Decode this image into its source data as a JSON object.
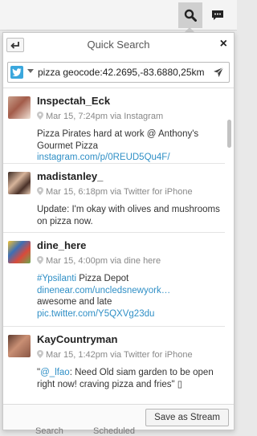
{
  "topbar": {
    "search_icon": "search-icon",
    "messages_icon": "chat-bubble-icon"
  },
  "panel": {
    "title": "Quick Search",
    "back_icon": "back-arrow-icon",
    "close_label": "×",
    "network_icon": "twitter-icon",
    "query_value": "pizza geocode:42.2695,-83.6880,25km",
    "send_icon": "paper-plane-icon"
  },
  "results": [
    {
      "user": "Inspectah_Eck",
      "meta": "Mar 15, 7:24pm via Instagram",
      "text": "Pizza Pirates hard at work @ Anthony's Gourmet Pizza",
      "link1": "instagram.com/p/0REUD5Qu4F/"
    },
    {
      "user": "madistanley_",
      "meta": "Mar 15, 6:18pm via Twitter for iPhone",
      "text": "Update: I'm okay with olives and mushrooms on pizza now."
    },
    {
      "user": "dine_here",
      "meta": "Mar 15, 4:00pm via dine here",
      "hashtag": "#Ypsilanti",
      "text_after_hashtag": " Pizza Depot",
      "link1": "dinenear.com/uncledsnewyork…",
      "text2": "awesome and late",
      "link2": "pic.twitter.com/Y5QXVg23du"
    },
    {
      "user": "KayCountryman",
      "meta": "Mar 15, 1:42pm via Twitter for iPhone",
      "quote_open": "\"",
      "mention": "@_lfao",
      "text": ": Need Old siam garden to be open right now! craving pizza and fries\" ▯"
    }
  ],
  "footer": {
    "save_label": "Save as Stream"
  },
  "background_tabs": {
    "search": "Search",
    "scheduled": "Scheduled"
  },
  "colors": {
    "accent": "#2f8fc6",
    "twitter": "#3aa7dd"
  }
}
